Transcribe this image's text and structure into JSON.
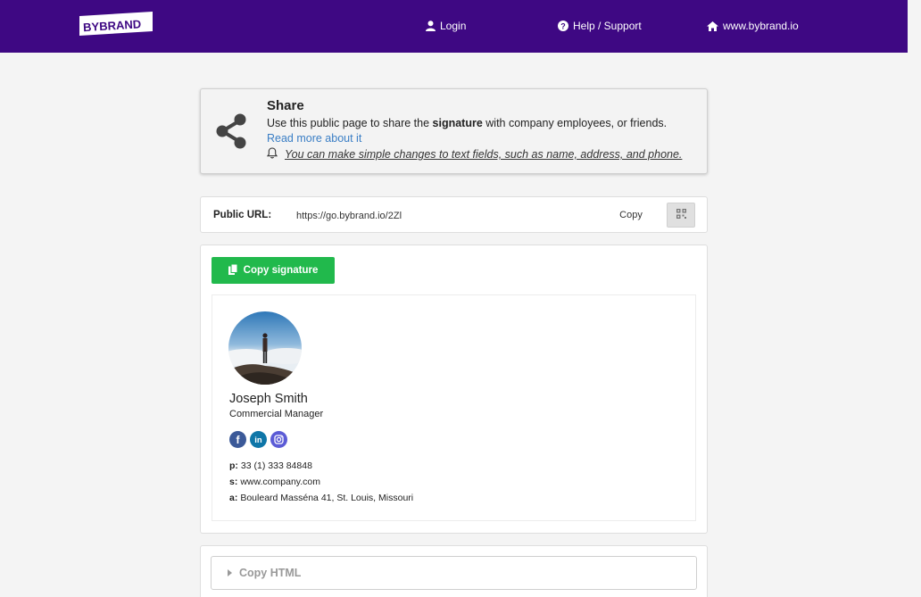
{
  "header": {
    "brand": "BYBRAND",
    "nav": {
      "login": "Login",
      "help": "Help / Support",
      "site": "www.bybrand.io"
    },
    "background": "#3e0883"
  },
  "share": {
    "title": "Share",
    "desc_prefix": "Use this public page to share the ",
    "desc_bold": "signature",
    "desc_suffix": " with company employees, or friends.",
    "read_more": "Read more about it",
    "note": "You can make simple changes to text fields, such as name, address, and phone."
  },
  "public_url": {
    "label": "Public URL:",
    "value": "https://go.bybrand.io/2Zl",
    "copy_label": "Copy",
    "qr_icon": "qr-code-icon"
  },
  "signature": {
    "copy_button": "Copy signature",
    "name": "Joseph Smith",
    "role": "Commercial Manager",
    "socials": [
      {
        "name": "facebook",
        "glyph": "f",
        "color": "#3b5998"
      },
      {
        "name": "linkedin",
        "glyph": "in",
        "color": "#0e76a8"
      },
      {
        "name": "instagram",
        "glyph": "ig",
        "color": "#5b5bd6"
      }
    ],
    "phone_label": "p:",
    "phone": "33 (1) 333 84848",
    "site_label": "s:",
    "site": "www.company.com",
    "address_label": "a:",
    "address": "Bouleard Masséna 41, St. Louis, Missouri"
  },
  "copy_html": {
    "label": "Copy HTML"
  },
  "colors": {
    "accent_green": "#21b94c",
    "link_blue": "#3a7ec5"
  }
}
